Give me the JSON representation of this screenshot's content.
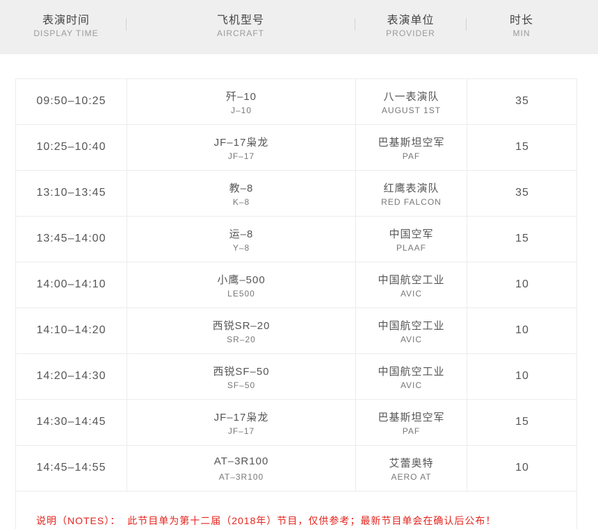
{
  "header": {
    "columns": [
      {
        "cn": "表演时间",
        "en": "DISPLAY TIME"
      },
      {
        "cn": "飞机型号",
        "en": "AIRCRAFT"
      },
      {
        "cn": "表演单位",
        "en": "PROVIDER"
      },
      {
        "cn": "时长",
        "en": "MIN"
      }
    ]
  },
  "rows": [
    {
      "time": "09:50–10:25",
      "aircraft_cn": "歼–10",
      "aircraft_en": "J–10",
      "provider_cn": "八一表演队",
      "provider_en": "AUGUST 1ST",
      "min": "35"
    },
    {
      "time": "10:25–10:40",
      "aircraft_cn": "JF–17枭龙",
      "aircraft_en": "JF–17",
      "provider_cn": "巴基斯坦空军",
      "provider_en": "PAF",
      "min": "15"
    },
    {
      "time": "13:10–13:45",
      "aircraft_cn": "教–8",
      "aircraft_en": "K–8",
      "provider_cn": "红鹰表演队",
      "provider_en": "RED FALCON",
      "min": "35"
    },
    {
      "time": "13:45–14:00",
      "aircraft_cn": "运–8",
      "aircraft_en": "Y–8",
      "provider_cn": "中国空军",
      "provider_en": "PLAAF",
      "min": "15"
    },
    {
      "time": "14:00–14:10",
      "aircraft_cn": "小鹰–500",
      "aircraft_en": "LE500",
      "provider_cn": "中国航空工业",
      "provider_en": "AVIC",
      "min": "10"
    },
    {
      "time": "14:10–14:20",
      "aircraft_cn": "西锐SR–20",
      "aircraft_en": "SR–20",
      "provider_cn": "中国航空工业",
      "provider_en": "AVIC",
      "min": "10"
    },
    {
      "time": "14:20–14:30",
      "aircraft_cn": "西锐SF–50",
      "aircraft_en": "SF–50",
      "provider_cn": "中国航空工业",
      "provider_en": "AVIC",
      "min": "10"
    },
    {
      "time": "14:30–14:45",
      "aircraft_cn": "JF–17枭龙",
      "aircraft_en": "JF–17",
      "provider_cn": "巴基斯坦空军",
      "provider_en": "PAF",
      "min": "15"
    },
    {
      "time": "14:45–14:55",
      "aircraft_cn": "AT–3R100",
      "aircraft_en": "AT–3R100",
      "provider_cn": "艾蕾奥特",
      "provider_en": "AERO AT",
      "min": "10"
    }
  ],
  "notes": {
    "label": "说明（NOTES）：",
    "text": "此节目单为第十二届（2018年）节目，仅供参考；最新节目单会在确认后公布！"
  }
}
